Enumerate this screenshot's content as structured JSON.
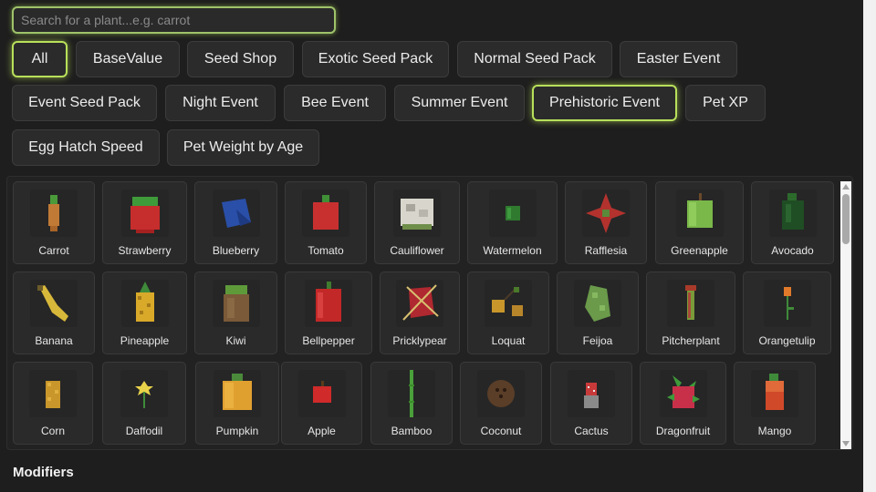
{
  "search": {
    "placeholder": "Search for a plant...e.g. carrot",
    "value": ""
  },
  "filters": [
    {
      "label": "All",
      "active": true
    },
    {
      "label": "BaseValue",
      "active": false
    },
    {
      "label": "Seed Shop",
      "active": false
    },
    {
      "label": "Exotic Seed Pack",
      "active": false
    },
    {
      "label": "Normal Seed Pack",
      "active": false
    },
    {
      "label": "Easter Event",
      "active": false
    },
    {
      "label": "Event Seed Pack",
      "active": false
    },
    {
      "label": "Night Event",
      "active": false
    },
    {
      "label": "Bee Event",
      "active": false
    },
    {
      "label": "Summer Event",
      "active": false
    },
    {
      "label": "Prehistoric Event",
      "active": true
    },
    {
      "label": "Pet XP",
      "active": false
    },
    {
      "label": "Egg Hatch Speed",
      "active": false
    },
    {
      "label": "Pet Weight by Age",
      "active": false
    }
  ],
  "plants": [
    {
      "name": "Carrot",
      "icon": "carrot-icon"
    },
    {
      "name": "Strawberry",
      "icon": "strawberry-icon"
    },
    {
      "name": "Blueberry",
      "icon": "blueberry-icon"
    },
    {
      "name": "Tomato",
      "icon": "tomato-icon"
    },
    {
      "name": "Cauliflower",
      "icon": "cauliflower-icon"
    },
    {
      "name": "Watermelon",
      "icon": "watermelon-icon"
    },
    {
      "name": "Rafflesia",
      "icon": "rafflesia-icon"
    },
    {
      "name": "Greenapple",
      "icon": "greenapple-icon"
    },
    {
      "name": "Avocado",
      "icon": "avocado-icon"
    },
    {
      "name": "Banana",
      "icon": "banana-icon"
    },
    {
      "name": "Pineapple",
      "icon": "pineapple-icon"
    },
    {
      "name": "Kiwi",
      "icon": "kiwi-icon"
    },
    {
      "name": "Bellpepper",
      "icon": "bellpepper-icon"
    },
    {
      "name": "Pricklypear",
      "icon": "pricklypear-icon"
    },
    {
      "name": "Loquat",
      "icon": "loquat-icon"
    },
    {
      "name": "Feijoa",
      "icon": "feijoa-icon"
    },
    {
      "name": "Pitcherplant",
      "icon": "pitcherplant-icon"
    },
    {
      "name": "Orangetulip",
      "icon": "orangetulip-icon"
    },
    {
      "name": "Corn",
      "icon": "corn-icon"
    },
    {
      "name": "Daffodil",
      "icon": "daffodil-icon"
    },
    {
      "name": "Pumpkin",
      "icon": "pumpkin-icon"
    },
    {
      "name": "Apple",
      "icon": "apple-icon"
    },
    {
      "name": "Bamboo",
      "icon": "bamboo-icon"
    },
    {
      "name": "Coconut",
      "icon": "coconut-icon"
    },
    {
      "name": "Cactus",
      "icon": "cactus-icon"
    },
    {
      "name": "Dragonfruit",
      "icon": "dragonfruit-icon"
    },
    {
      "name": "Mango",
      "icon": "mango-icon"
    }
  ],
  "modifiers": {
    "heading": "Modifiers"
  },
  "colors": {
    "accent": "#b8e05a",
    "background": "#1e1e1e",
    "card": "#2a2a2a"
  }
}
